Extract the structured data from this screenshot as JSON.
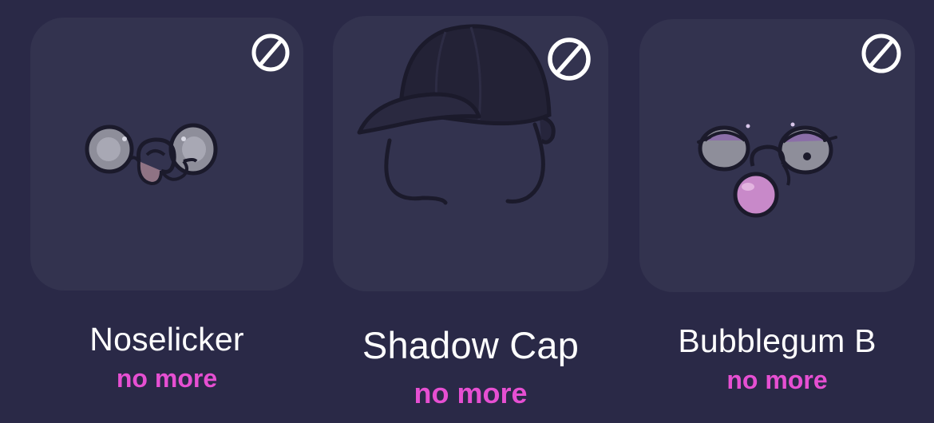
{
  "items": [
    {
      "name": "Noselicker",
      "status": "no more",
      "icon": "koala-tongue-face"
    },
    {
      "name": "Shadow Cap",
      "status": "no more",
      "icon": "baseball-cap"
    },
    {
      "name": "Bubblegum B",
      "status": "no more",
      "icon": "koala-bubblegum-face"
    }
  ],
  "badge_icon": "prohibited-icon",
  "colors": {
    "background": "#2a2947",
    "tile": "#33334f",
    "name": "#ffffff",
    "status": "#e64fd2"
  }
}
